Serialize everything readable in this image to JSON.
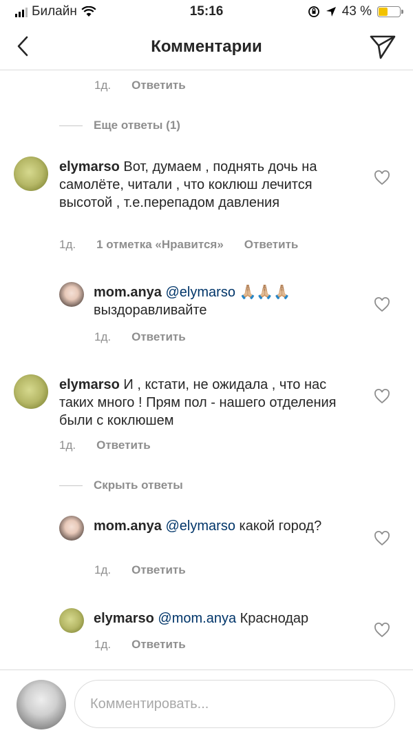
{
  "status_bar": {
    "carrier": "Билайн",
    "time": "15:16",
    "battery_percent": "43 %",
    "battery_level": 0.43
  },
  "header": {
    "title": "Комментарии",
    "back_icon": "chevron-left-icon",
    "send_icon": "paper-plane-icon"
  },
  "items": {
    "top_meta": {
      "time": "1д.",
      "reply": "Ответить"
    },
    "more_replies": "Еще ответы (1)",
    "c1": {
      "user": "elymarso",
      "text": "Вот, думаем , поднять дочь на самолёте, читали , что коклюш лечится высотой , т.е.перепадом давления",
      "time": "1д.",
      "likes": "1 отметка «Нравится»",
      "reply": "Ответить"
    },
    "r1": {
      "user": "mom.anya",
      "mention": "@elymarso",
      "emoji": "🙏🏼🙏🏼🙏🏼",
      "text": "выздоравливайте",
      "time": "1д.",
      "reply": "Ответить"
    },
    "c2": {
      "user": "elymarso",
      "text": "И , кстати, не ожидала , что нас таких много ! Прям пол - нашего отделения были с коклюшем",
      "time": "1д.",
      "reply": "Ответить"
    },
    "hide_replies": "Скрыть ответы",
    "r2": {
      "user": "mom.anya",
      "mention": "@elymarso",
      "text": "какой город?",
      "time": "1д.",
      "reply": "Ответить"
    },
    "r3": {
      "user": "elymarso",
      "mention": "@mom.anya",
      "text": "Краснодар",
      "time": "1д.",
      "reply": "Ответить"
    }
  },
  "input": {
    "placeholder": "Комментировать..."
  }
}
